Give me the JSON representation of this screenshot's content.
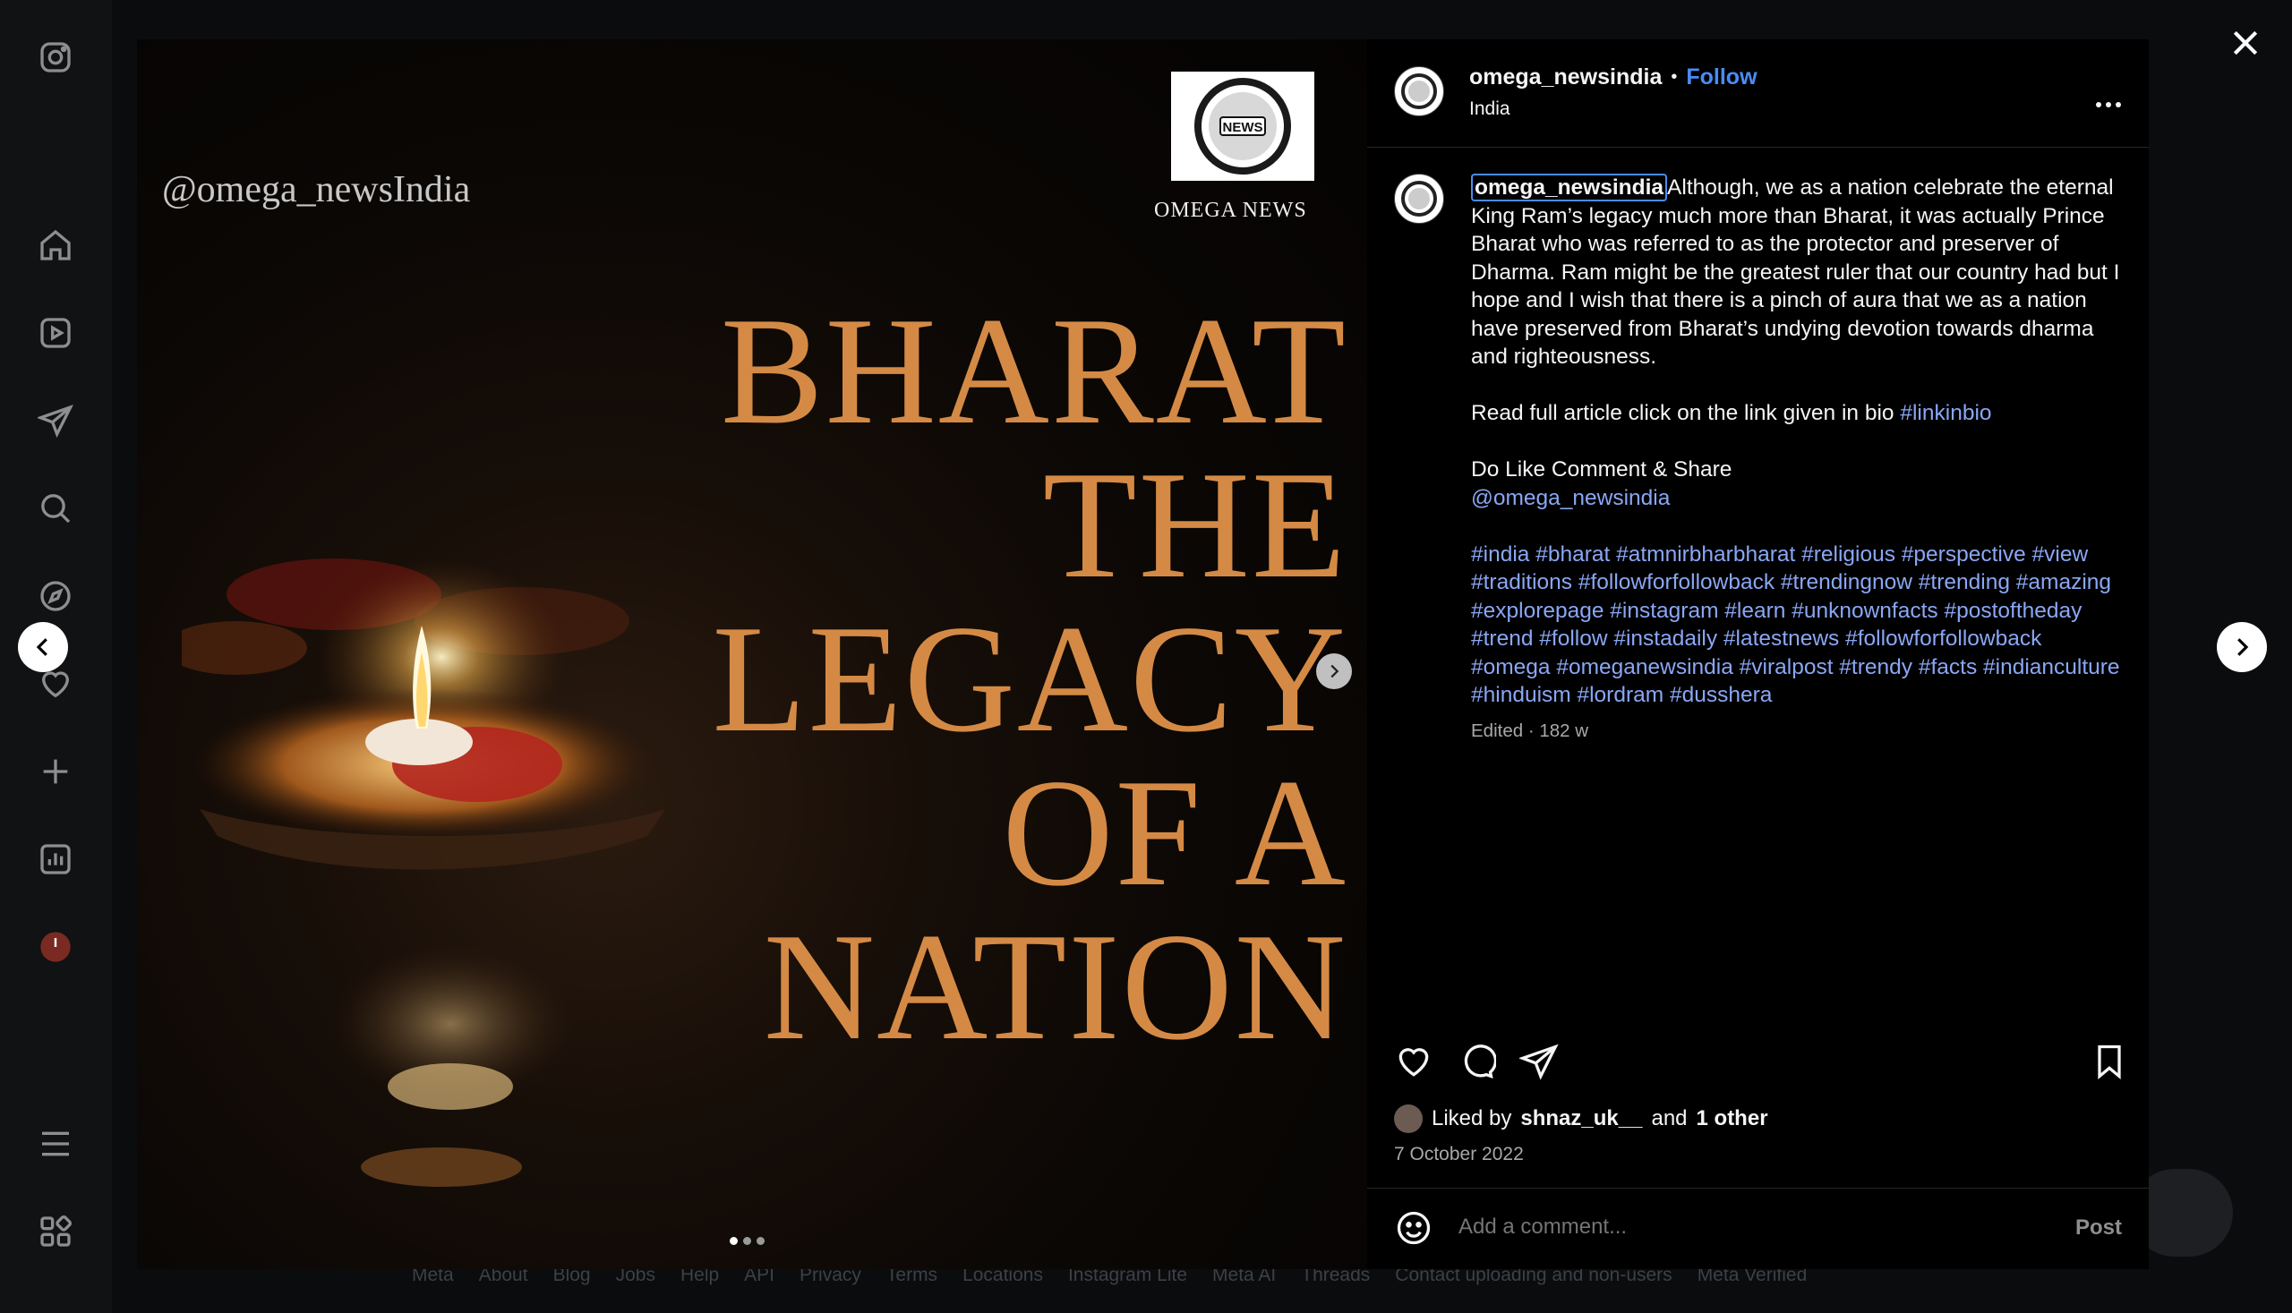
{
  "sidebar": {
    "items": [
      {
        "name": "instagram-logo-icon"
      },
      {
        "name": "home-icon"
      },
      {
        "name": "reels-icon"
      },
      {
        "name": "messages-icon"
      },
      {
        "name": "search-icon"
      },
      {
        "name": "explore-icon"
      },
      {
        "name": "notifications-icon"
      },
      {
        "name": "create-icon"
      },
      {
        "name": "dashboard-icon"
      },
      {
        "name": "profile-avatar"
      },
      {
        "name": "menu-icon"
      },
      {
        "name": "meta-apps-icon"
      }
    ]
  },
  "image": {
    "handle": "@omega_newsIndia",
    "logo_label": "OMEGA NEWS",
    "logo_badge": "NEWS",
    "title_lines": [
      "BHARAT",
      "THE",
      "LEGACY",
      "OF A",
      "NATION"
    ],
    "title_color": "#d48a45",
    "carousel_count": 3,
    "carousel_active": 1
  },
  "post": {
    "username": "omega_newsindia",
    "follow_label": "Follow",
    "separator": "•",
    "location": "India",
    "more_label": "...",
    "caption": {
      "owner": "omega_newsindia",
      "text": "Although, we as a nation celebrate the eternal King Ram’s legacy much more than Bharat, it was actually Prince Bharat who was referred to as the protector and preserver of Dharma. Ram might be the greatest ruler that our country had but I hope and I wish that there is a pinch of aura that we as a nation have preserved from Bharat’s undying devotion towards dharma and righteousness.",
      "read_more": "Read full article click on the link given in bio ",
      "read_more_tag": "#linkinbio",
      "cta": "Do Like Comment & Share",
      "mention": "@omega_newsindia",
      "hashtags": "#india #bharat #atmnirbharbharat #religious #perspective #view #traditions #followforfollowback #trendingnow #trending #amazing #explorepage #instagram #learn #unknownfacts #postoftheday #trend #follow #instadaily #latestnews #followforfollowback #omega #omeganewsindia #viralpost #trendy #facts #indianculture #hinduism #lordram #dusshera",
      "edited": "Edited · 182 w"
    },
    "likes": {
      "prefix": "Liked by",
      "user": "shnaz_uk__",
      "middle": "and",
      "others": "1 other"
    },
    "date": "7 October 2022",
    "comment_placeholder": "Add a comment...",
    "post_label": "Post"
  },
  "footer": {
    "links": [
      "Meta",
      "About",
      "Blog",
      "Jobs",
      "Help",
      "API",
      "Privacy",
      "Terms",
      "Locations",
      "Instagram Lite",
      "Meta AI",
      "Threads",
      "Contact uploading and non-users",
      "Meta Verified"
    ]
  },
  "colors": {
    "accent": "#4a8cf7",
    "hashtag": "#8aa7f5",
    "panel_bg": "#000000"
  }
}
